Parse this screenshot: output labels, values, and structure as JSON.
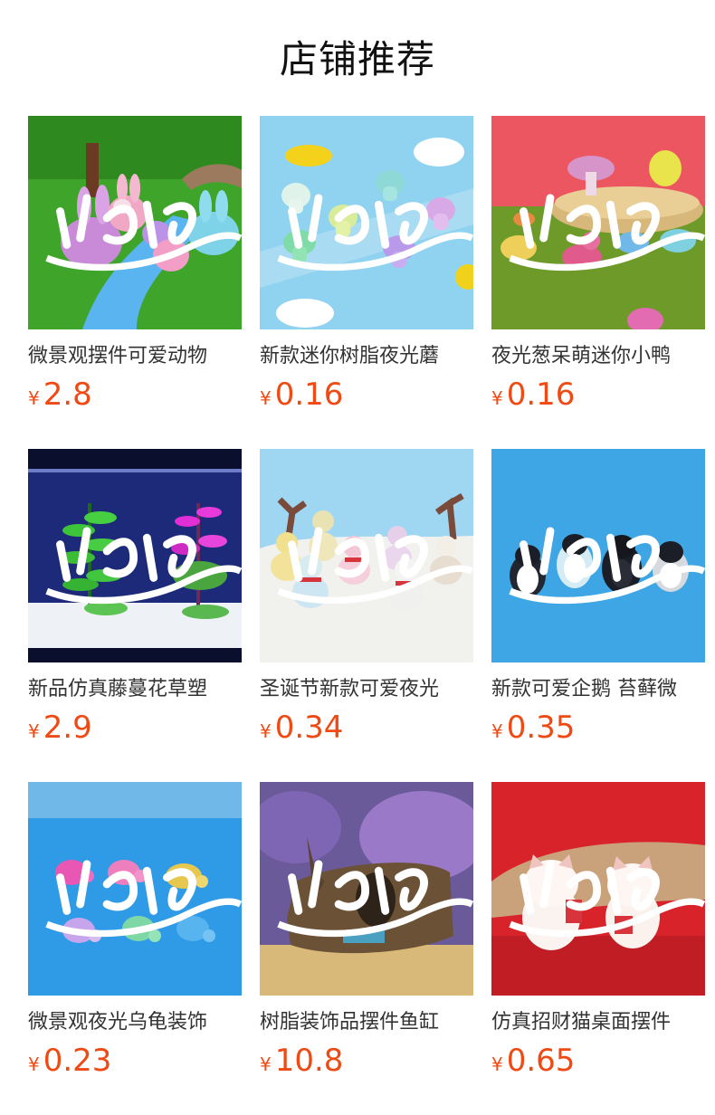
{
  "page": {
    "title": "店铺推荐"
  },
  "colors": {
    "price": "#ef4a14",
    "title_text": "#111111",
    "name_text": "#333333"
  },
  "currency_symbol": "¥",
  "products": [
    {
      "name": "微景观摆件可爱动物",
      "price": "2.8",
      "image": "glowing-bunnies-on-grass-image"
    },
    {
      "name": "新款迷你树脂夜光蘑",
      "price": "0.16",
      "image": "glowing-mushrooms-on-blue-image"
    },
    {
      "name": "夜光葱呆萌迷你小鸭",
      "price": "0.16",
      "image": "ducks-on-moss-red-background-image"
    },
    {
      "name": "新品仿真藤蔓花草塑",
      "price": "2.9",
      "image": "aquarium-plants-image"
    },
    {
      "name": "圣诞节新款可爱夜光",
      "price": "0.34",
      "image": "glowing-snowmen-image"
    },
    {
      "name": "新款可爱企鹅 苔藓微",
      "price": "0.35",
      "image": "penguin-figures-image"
    },
    {
      "name": "微景观夜光乌龟装饰",
      "price": "0.23",
      "image": "glowing-turtles-on-blue-sand-image"
    },
    {
      "name": "树脂装饰品摆件鱼缸",
      "price": "10.8",
      "image": "resin-log-aquarium-ornament-image"
    },
    {
      "name": "仿真招财猫桌面摆件",
      "price": "0.65",
      "image": "lucky-cat-figures-image"
    }
  ]
}
